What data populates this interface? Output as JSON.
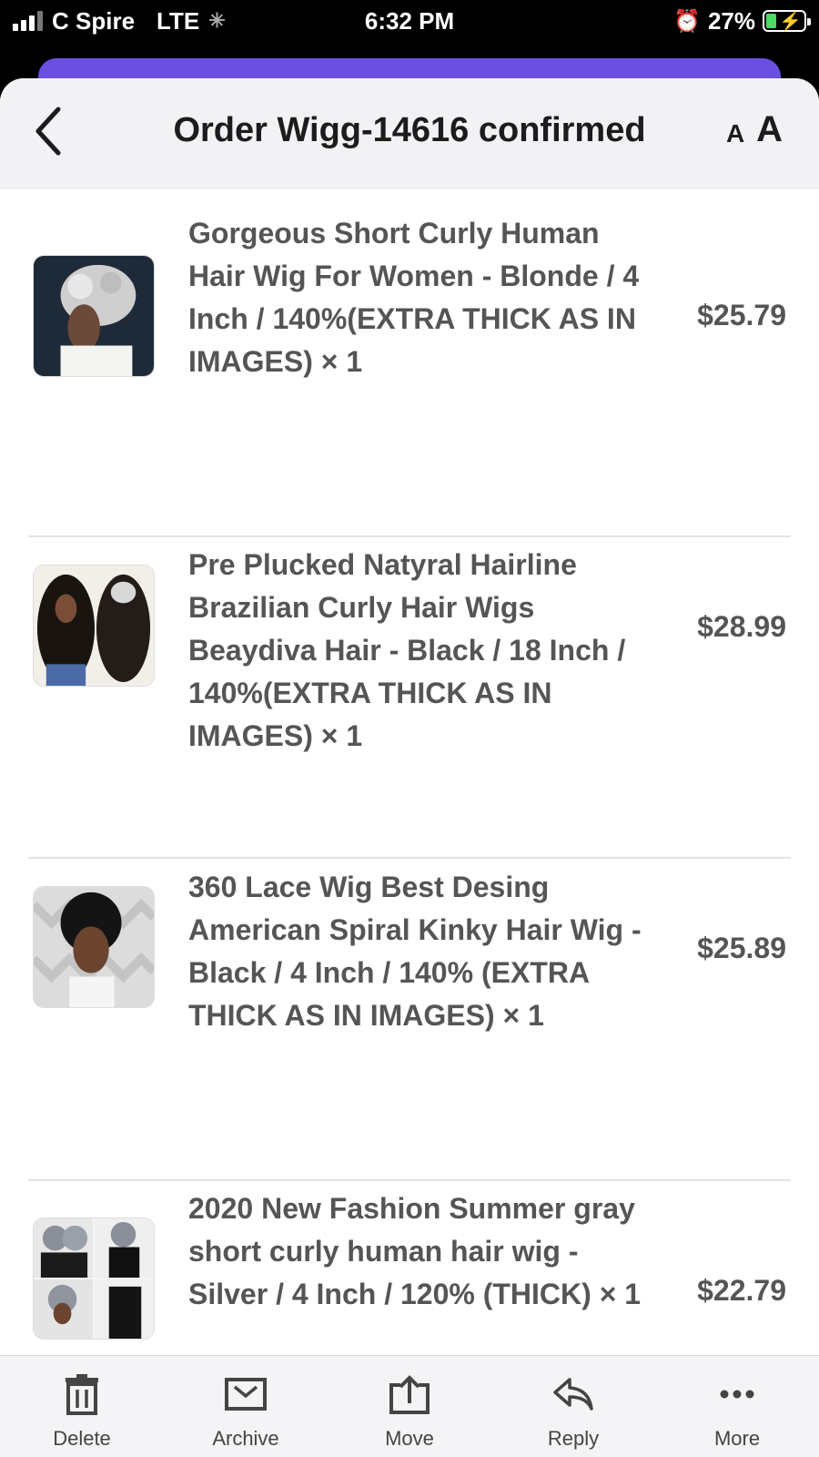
{
  "status_bar": {
    "carrier": "C Spire",
    "network": "LTE",
    "time": "6:32 PM",
    "battery_percent": "27%",
    "battery_level": 0.27
  },
  "header": {
    "title": "Order Wigg-14616 confirmed"
  },
  "items": [
    {
      "title": "Gorgeous Short Curly Human Hair Wig For Women - Blonde / 4 Inch / 140%(EXTRA THICK AS IN IMAGES) × 1",
      "price": "$25.79"
    },
    {
      "title": "Pre Plucked Natyral Hairline Brazilian Curly Hair Wigs Beaydiva Hair - Black / 18 Inch / 140%(EXTRA THICK AS IN IMAGES) × 1",
      "price": "$28.99"
    },
    {
      "title": "360 Lace Wig Best Desing American Spiral Kinky Hair Wig - Black / 4 Inch / 140% (EXTRA THICK AS IN IMAGES) × 1",
      "price": "$25.89"
    },
    {
      "title": "2020 New Fashion Summer gray short curly human hair wig - Silver / 4 Inch / 120% (THICK) × 1",
      "price": "$22.79"
    }
  ],
  "toolbar": {
    "delete": "Delete",
    "archive": "Archive",
    "move": "Move",
    "reply": "Reply",
    "more": "More"
  },
  "colors": {
    "accent_purple": "#6a4fe0",
    "text_dark": "#1c1c1e",
    "text_item": "#555555",
    "battery_green": "#4cd964"
  }
}
